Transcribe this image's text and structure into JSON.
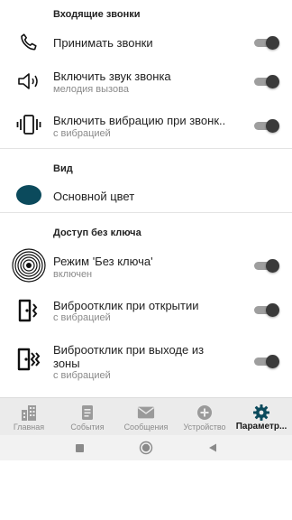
{
  "sections": {
    "incoming": {
      "header": "Входящие звонки",
      "accept": {
        "title": "Принимать звонки",
        "enabled": true
      },
      "ringtone": {
        "title": "Включить звук звонка",
        "subtitle": "мелодия вызова",
        "enabled": true
      },
      "vibration": {
        "title": "Включить вибрацию при звонк..",
        "subtitle": "с вибрацией",
        "enabled": true
      }
    },
    "view": {
      "header": "Вид",
      "main_color": {
        "title": "Основной цвет",
        "color": "#0b4a5c"
      }
    },
    "keyless": {
      "header": "Доступ без ключа",
      "mode": {
        "title": "Режим 'Без ключа'",
        "subtitle": "включен",
        "enabled": true
      },
      "vibro_open": {
        "title": "Виброотклик при открытии",
        "subtitle": "с вибрацией",
        "enabled": true
      },
      "vibro_exit": {
        "title_line1": "Виброотклик при выходе из",
        "title_line2": "зоны",
        "subtitle": "с вибрацией",
        "enabled": true
      }
    }
  },
  "bottom_nav": {
    "items": [
      {
        "label": "Главная",
        "icon": "building-icon"
      },
      {
        "label": "События",
        "icon": "document-icon"
      },
      {
        "label": "Сообщения",
        "icon": "envelope-icon"
      },
      {
        "label": "Устройство",
        "icon": "add-circle-icon"
      },
      {
        "label": "Параметр...",
        "icon": "gear-icon",
        "active": true
      }
    ]
  },
  "system_nav": {
    "buttons": [
      "recents-button",
      "home-button",
      "back-button"
    ]
  },
  "colors": {
    "toggle_track": "#9e9e9e",
    "toggle_thumb": "#3a3a3a",
    "accent": "#0b4a5c",
    "nav_background": "#ebebeb"
  }
}
